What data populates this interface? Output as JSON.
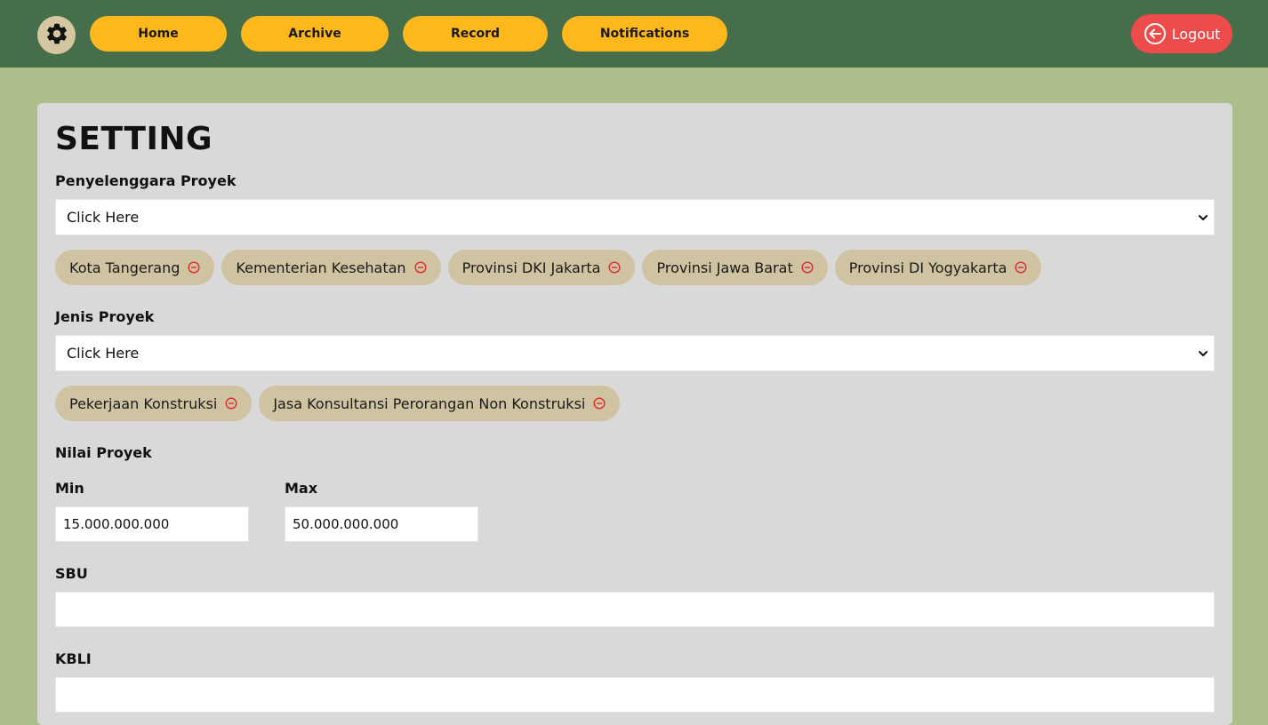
{
  "nav": {
    "settings_icon": "gear-icon",
    "items": [
      {
        "label": "Home"
      },
      {
        "label": "Archive"
      },
      {
        "label": "Record"
      },
      {
        "label": "Notifications"
      }
    ],
    "logout": {
      "label": "Logout",
      "icon": "logout-arrow-icon"
    }
  },
  "page": {
    "title": "SETTING",
    "penyelenggara": {
      "label": "Penyelenggara Proyek",
      "select_value": "Click Here",
      "chips": [
        {
          "label": "Kota Tangerang"
        },
        {
          "label": "Kementerian Kesehatan"
        },
        {
          "label": "Provinsi DKI Jakarta"
        },
        {
          "label": "Provinsi Jawa Barat"
        },
        {
          "label": "Provinsi DI Yogyakarta"
        }
      ]
    },
    "jenis": {
      "label": "Jenis Proyek",
      "select_value": "Click Here",
      "chips": [
        {
          "label": "Pekerjaan Konstruksi"
        },
        {
          "label": "Jasa Konsultansi Perorangan Non Konstruksi"
        }
      ]
    },
    "nilai": {
      "label": "Nilai Proyek",
      "min_label": "Min",
      "min_value": "15.000.000.000",
      "max_label": "Max",
      "max_value": "50.000.000.000"
    },
    "sbu": {
      "label": "SBU",
      "value": ""
    },
    "kbli": {
      "label": "KBLI",
      "value": ""
    }
  },
  "colors": {
    "topbar": "#466e4a",
    "background": "#acbe89",
    "nav_button": "#ffb81c",
    "logout_button": "#ee4b4b",
    "card": "#d9d9d9",
    "chip": "#cfc3a2",
    "chip_remove_icon": "#e02b2b"
  }
}
